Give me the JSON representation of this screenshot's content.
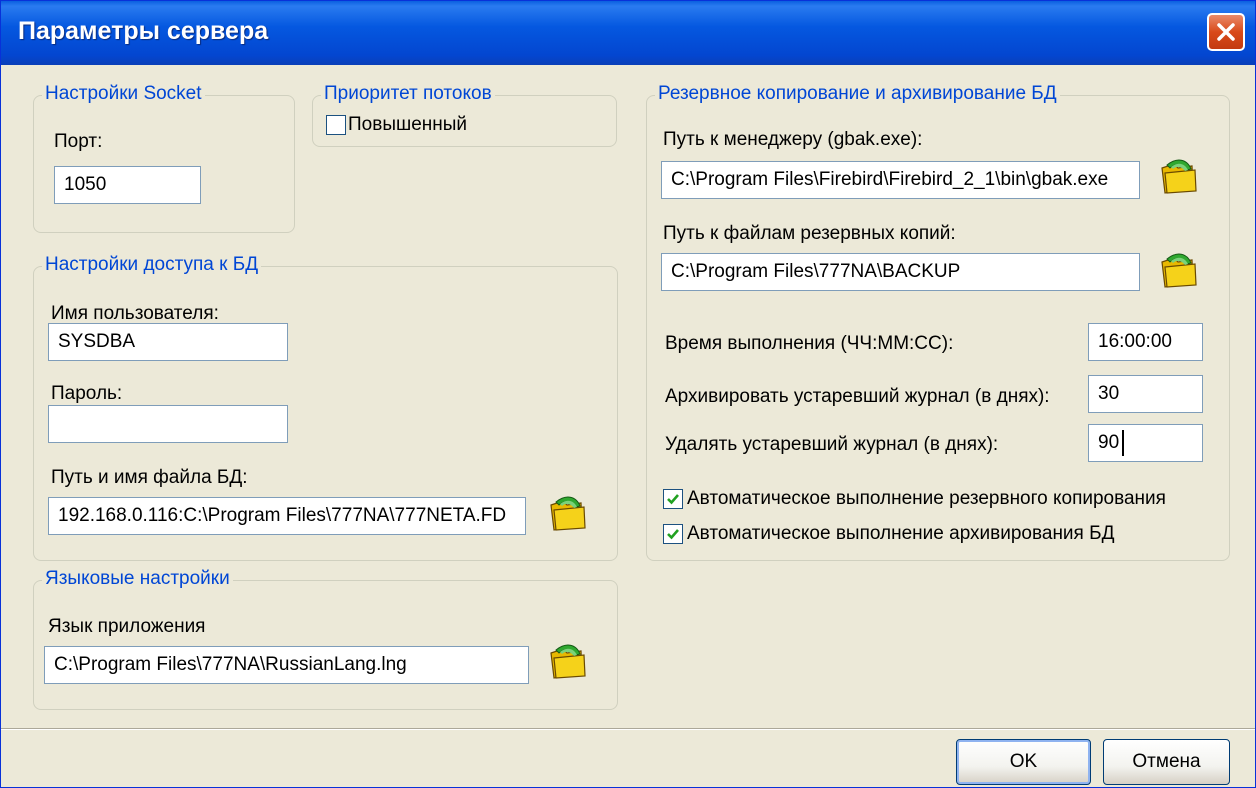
{
  "window": {
    "title": "Параметры сервера"
  },
  "socket": {
    "legend": "Настройки Socket",
    "port_label": "Порт:",
    "port_value": "1050"
  },
  "threads": {
    "legend": "Приоритет потоков",
    "elevated_label": "Повышенный",
    "elevated_checked": false
  },
  "db_access": {
    "legend": "Настройки доступа к БД",
    "user_label": "Имя пользователя:",
    "user_value": "SYSDBA",
    "password_label": "Пароль:",
    "password_value": "",
    "path_label": "Путь и имя файла БД:",
    "path_value": "192.168.0.116:C:\\Program Files\\777NA\\777NETA.FD"
  },
  "language": {
    "legend": "Языковые настройки",
    "lang_label": "Язык приложения",
    "lang_value": "C:\\Program Files\\777NA\\RussianLang.lng"
  },
  "backup": {
    "legend": "Резервное копирование и архивирование БД",
    "manager_label": "Путь к менеджеру (gbak.exe):",
    "manager_value": "C:\\Program Files\\Firebird\\Firebird_2_1\\bin\\gbak.exe",
    "backup_path_label": "Путь к файлам резервных копий:",
    "backup_path_value": "C:\\Program Files\\777NA\\BACKUP",
    "time_label": "Время выполнения (ЧЧ:ММ:СС):",
    "time_value": "16:00:00",
    "archive_label": "Архивировать устаревший журнал (в днях):",
    "archive_value": "30",
    "delete_label": "Удалять устаревший журнал (в днях):",
    "delete_value": "90",
    "auto_backup_label": "Автоматическое выполнение резервного копирования",
    "auto_backup_checked": true,
    "auto_archive_label": "Автоматическое выполнение архивирования БД",
    "auto_archive_checked": true
  },
  "buttons": {
    "ok": "OK",
    "cancel": "Отмена"
  },
  "icons": {
    "browse": "folder-open-icon",
    "close": "close-icon",
    "check": "checkmark-icon"
  },
  "colors": {
    "title_bar": "#0558e0",
    "legend_text": "#0046d5",
    "check_mark": "#21a121",
    "close_button": "#d94a1a"
  }
}
